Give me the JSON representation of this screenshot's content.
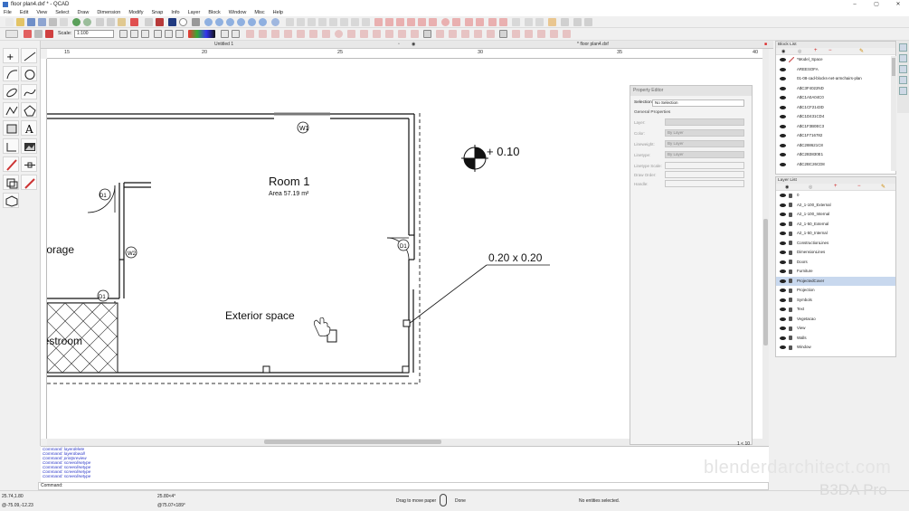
{
  "window": {
    "title": "floor plan4.dxf * - QCAD",
    "minimize": "–",
    "maximize": "▢",
    "close": "✕"
  },
  "menu": [
    "File",
    "Edit",
    "View",
    "Select",
    "Draw",
    "Dimension",
    "Modify",
    "Snap",
    "Info",
    "Layer",
    "Block",
    "Window",
    "Misc",
    "Help"
  ],
  "toolbar": {
    "scale_label": "Scale:",
    "scale_value": "1:100"
  },
  "doc_tabs": {
    "untitled": "Untitled 1",
    "active": "* floor plan4.dxf"
  },
  "ruler": {
    "h_ticks": [
      "15",
      "20",
      "25",
      "30",
      "35",
      "40"
    ],
    "h_tick_frac": [
      0.028,
      0.22,
      0.41,
      0.605,
      0.8,
      0.99
    ]
  },
  "drawing": {
    "room_name": "Room 1",
    "room_area": "Area 57.19 m²",
    "storage": "Storage",
    "restroom": "Restroom",
    "exterior": "Exterior space",
    "elevation": "+ 0.10",
    "column_dim": "0.20 x 0.20",
    "window_tag_1": "W1",
    "window_tag_2": "W2",
    "door_tag": "D1"
  },
  "property_editor": {
    "title": "Property Editor",
    "selection_label": "Selection:",
    "selection_value": "No Selection",
    "section": "General Properties",
    "fields": [
      {
        "label": "Layer:",
        "value": ""
      },
      {
        "label": "Color:",
        "value": "By Layer"
      },
      {
        "label": "Lineweight:",
        "value": "By Layer"
      },
      {
        "label": "Linetype:",
        "value": "By Layer"
      },
      {
        "label": "Linetype Scale:",
        "value": ""
      },
      {
        "label": "Draw Order:",
        "value": ""
      },
      {
        "label": "Handle:",
        "value": ""
      }
    ]
  },
  "block_list": {
    "title": "Block List",
    "items": [
      "*Model_Space",
      "AREESOFA",
      "01-08-cad-blocks-net-armchairs-plan",
      "A$C3F4022ND",
      "A$C1A0A04C0",
      "A$C1CF2143D",
      "A$C1D431CD4",
      "A$C1F3B0EC3",
      "A$C1F716782",
      "A$C288621C8",
      "A$C2B3830E1",
      "A$C2BC26CD8"
    ]
  },
  "layer_list": {
    "title": "Layer List",
    "items": [
      "0",
      "A2_1-100_External",
      "A2_1-100_Internal",
      "A2_1-50_External",
      "A2_1-50_Internal",
      "ConstructionLines",
      "DimensionLines",
      "Doors",
      "Furniture",
      "ProjectedCover",
      "Projection",
      "Symbols",
      "Text",
      "Vegetacao",
      "View",
      "Walls",
      "Window"
    ],
    "highlighted": "ProjectedCover"
  },
  "command_history": [
    "Command: layerdelete",
    "Command: layerdowall",
    "Command: printpreview",
    "Command: screenlinetype",
    "Command: screenlinetype",
    "Command: screenlinetype",
    "Command: screenlinetype"
  ],
  "command_prompt": "Command:",
  "status": {
    "coord_abs": "25.74,1.80",
    "coord_rel": "@-75.09,-12.23",
    "coord_polar": "25.80<4°",
    "coord_polar_rel": "@75.07<189°",
    "hint_left": "Drag to move paper",
    "hint_right": "Done",
    "selection": "No entities selected.",
    "zoom_ratio": "1 < 10"
  },
  "watermark": {
    "line1": "blenderdarchitect.com",
    "line2": "B3DA Pro"
  }
}
